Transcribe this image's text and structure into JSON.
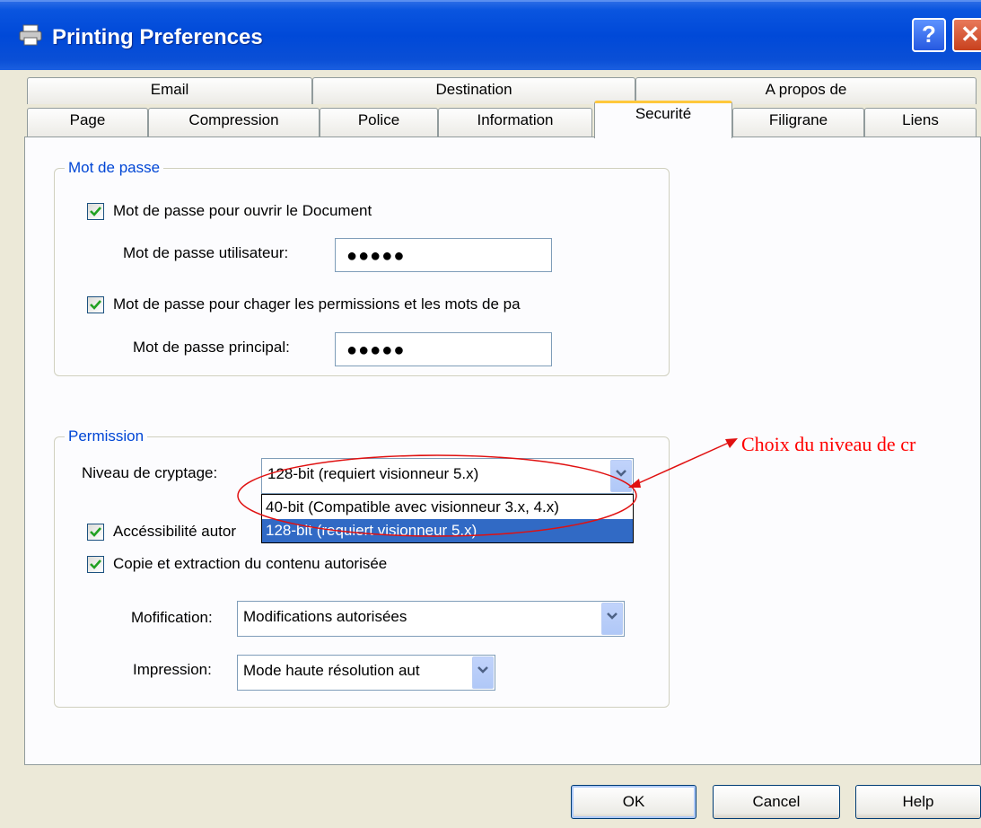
{
  "window": {
    "title": "Printing Preferences",
    "help_glyph": "?",
    "close_glyph": "✕"
  },
  "tabs": {
    "row1": [
      "Email",
      "Destination",
      "A propos de"
    ],
    "row2": [
      "Page",
      "Compression",
      "Police",
      "Information",
      "Securité",
      "Filigrane",
      "Liens"
    ],
    "selected": "Securité"
  },
  "password_group": {
    "legend": "Mot de passe",
    "open_doc_label": "Mot de passe pour ouvrir le Document",
    "open_doc_checked": true,
    "user_pw_label": "Mot de passe utilisateur:",
    "user_pw_value": "●●●●●",
    "perm_label": "Mot de passe pour chager les permissions et les mots de pa",
    "perm_checked": true,
    "master_pw_label": "Mot de passe principal:",
    "master_pw_value": "●●●●●"
  },
  "permission_group": {
    "legend": "Permission",
    "encryption_label": "Niveau de cryptage:",
    "encryption_value": "128-bit (requiert visionneur 5.x)",
    "encryption_options": [
      "40-bit (Compatible avec visionneur 3.x, 4.x)",
      "128-bit (requiert visionneur 5.x)"
    ],
    "accessibility_label": "Accéssibilité autor",
    "accessibility_checked": true,
    "copy_label": "Copie et extraction du contenu autorisée",
    "copy_checked": true,
    "modification_label": "Mofification:",
    "modification_value": "Modifications autorisées",
    "printing_label": "Impression:",
    "printing_value": "Mode haute résolution aut"
  },
  "buttons": {
    "ok": "OK",
    "cancel": "Cancel",
    "help": "Help"
  },
  "annotation": {
    "text": "Choix du niveau de cr",
    "color": "#ff0000"
  }
}
